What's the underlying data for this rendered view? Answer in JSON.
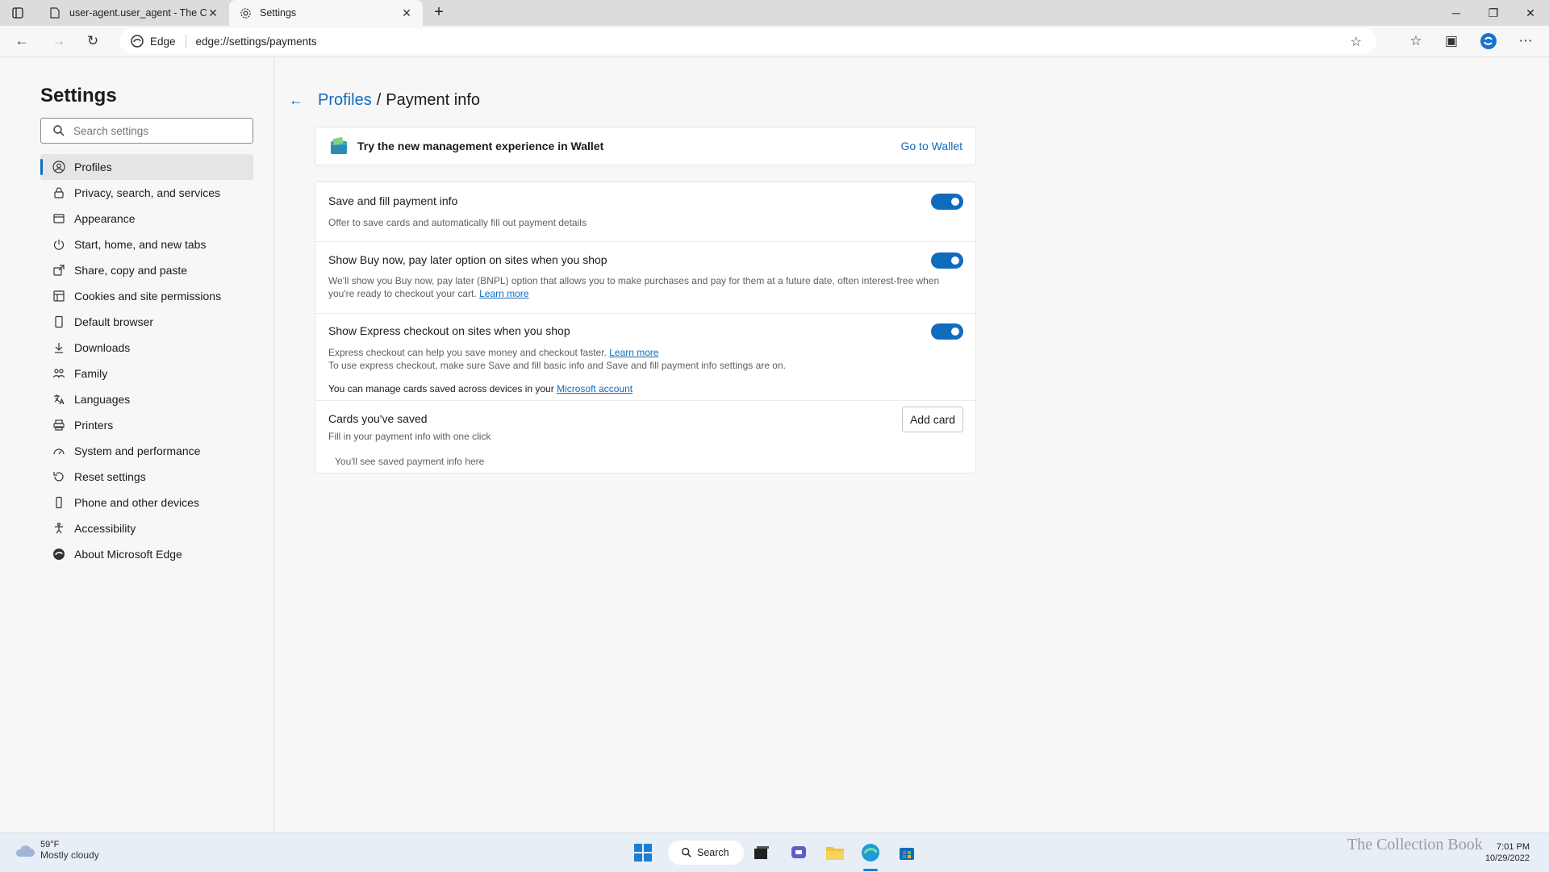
{
  "browser": {
    "tabs": [
      {
        "title": "user-agent.user_agent - The Coll",
        "active": false
      },
      {
        "title": "Settings",
        "active": true
      }
    ],
    "address": {
      "site_label": "Edge",
      "url": "edge://settings/payments"
    }
  },
  "sidebar": {
    "title": "Settings",
    "search_placeholder": "Search settings",
    "items": [
      {
        "label": "Profiles",
        "icon": "profile-icon"
      },
      {
        "label": "Privacy, search, and services",
        "icon": "lock-icon"
      },
      {
        "label": "Appearance",
        "icon": "appearance-icon"
      },
      {
        "label": "Start, home, and new tabs",
        "icon": "power-icon"
      },
      {
        "label": "Share, copy and paste",
        "icon": "share-icon"
      },
      {
        "label": "Cookies and site permissions",
        "icon": "cookie-icon"
      },
      {
        "label": "Default browser",
        "icon": "browser-icon"
      },
      {
        "label": "Downloads",
        "icon": "download-icon"
      },
      {
        "label": "Family",
        "icon": "family-icon"
      },
      {
        "label": "Languages",
        "icon": "language-icon"
      },
      {
        "label": "Printers",
        "icon": "printer-icon"
      },
      {
        "label": "System and performance",
        "icon": "system-icon"
      },
      {
        "label": "Reset settings",
        "icon": "reset-icon"
      },
      {
        "label": "Phone and other devices",
        "icon": "phone-icon"
      },
      {
        "label": "Accessibility",
        "icon": "accessibility-icon"
      },
      {
        "label": "About Microsoft Edge",
        "icon": "edge-icon"
      }
    ]
  },
  "page": {
    "breadcrumb_parent": "Profiles",
    "breadcrumb_sep": "/",
    "breadcrumb_current": "Payment info",
    "wallet": {
      "text": "Try the new management experience in Wallet",
      "link": "Go to Wallet"
    },
    "save_fill": {
      "title": "Save and fill payment info",
      "desc": "Offer to save cards and automatically fill out payment details",
      "enabled": true
    },
    "bnpl": {
      "title": "Show Buy now, pay later option on sites when you shop",
      "desc": "We'll show you Buy now, pay later (BNPL) option that allows you to make purchases and pay for them at a future date, often interest-free when you're ready to checkout your cart.",
      "link": "Learn more",
      "enabled": true
    },
    "express": {
      "title": "Show Express checkout on sites when you shop",
      "desc1": "Express checkout can help you save money and checkout faster.",
      "link": "Learn more",
      "desc2": "To use express checkout, make sure Save and fill basic info and Save and fill payment info settings are on.",
      "enabled": true
    },
    "manage": {
      "text": "You can manage cards saved across devices in your",
      "link": "Microsoft account"
    },
    "cards": {
      "title": "Cards you've saved",
      "desc": "Fill in your payment info with one click",
      "button": "Add card",
      "empty": "You'll see saved payment info here"
    }
  },
  "taskbar": {
    "weather_temp": "59°F",
    "weather_desc": "Mostly cloudy",
    "search_label": "Search",
    "time": "7:01 PM",
    "date": "10/29/2022"
  },
  "watermark": "The Collection Book",
  "colors": {
    "accent": "#0f6cbd"
  }
}
